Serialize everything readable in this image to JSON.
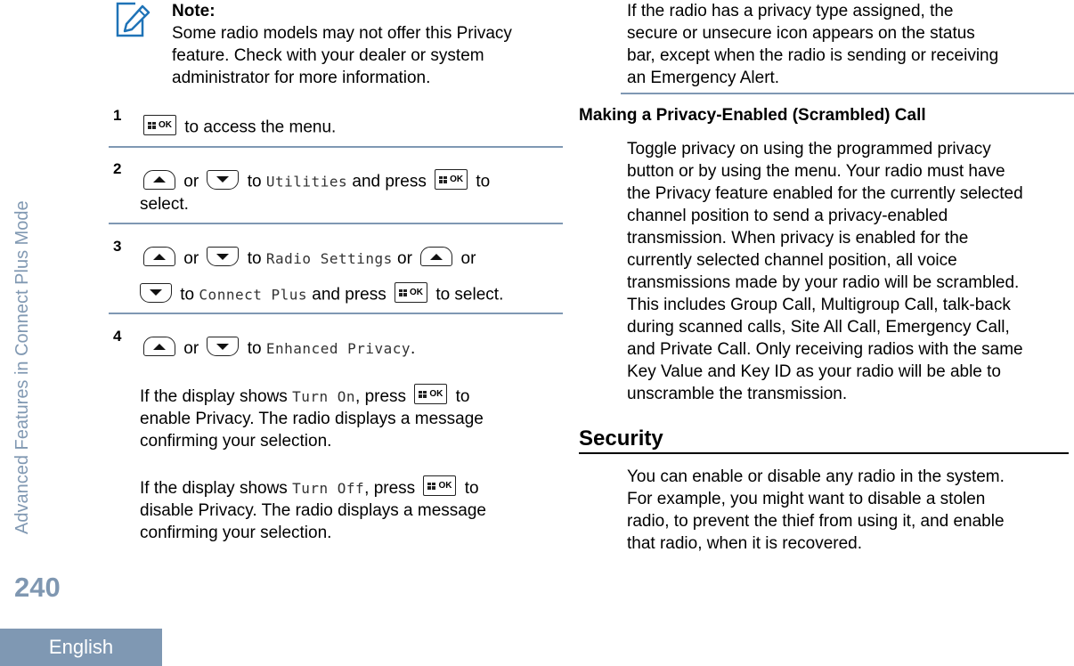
{
  "sidebar": {
    "section_title": "Advanced Features in Connect Plus Mode",
    "page_number": "240",
    "language": "English"
  },
  "colors": {
    "accent": "#7f98b3",
    "note_icon": "#1f73b7"
  },
  "note": {
    "icon": "pencil-note-icon",
    "label": "Note:",
    "lines": [
      "Some radio models may not offer this Privacy",
      "feature. Check with your dealer or system",
      "administrator for more information."
    ]
  },
  "keys": {
    "ok_label": "OK",
    "menu_ok_icon": "menu-ok-key-icon",
    "up_icon": "up-arrow-key-icon",
    "down_icon": "down-arrow-key-icon"
  },
  "steps": [
    {
      "number": "1",
      "text_after_ok": "to access the menu."
    },
    {
      "number": "2",
      "or": "or",
      "to": "to",
      "menu_item": "Utilities",
      "and_press": "and press",
      "to_trail": "to",
      "line2": "select."
    },
    {
      "number": "3",
      "or": "or",
      "to": "to",
      "menu_item_1": "Radio Settings",
      "or_mid": "or",
      "or_end": "or",
      "menu_item_2": "Connect Plus",
      "and_press": "and press",
      "to_select": "to select."
    },
    {
      "number": "4",
      "or": "or",
      "to": "to",
      "menu_item": "Enhanced Privacy",
      "period": ".",
      "on_para": {
        "prefix": "If the display shows",
        "display_value": "Turn On",
        "press": ", press",
        "to": "to",
        "line2": "enable Privacy. The radio displays a message",
        "line3": "confirming your selection."
      },
      "off_para": {
        "prefix": "If the display shows",
        "display_value": "Turn Off",
        "press": ", press",
        "to": "to",
        "line2": "disable Privacy. The radio displays a message",
        "line3": "confirming your selection."
      }
    }
  ],
  "right": {
    "status_para": [
      "If the radio has a privacy type assigned, the",
      "secure or unsecure icon appears on the status",
      "bar, except when the radio is sending or receiving",
      "an Emergency Alert."
    ],
    "scrambled_heading": "Making a Privacy-Enabled (Scrambled) Call",
    "scrambled_para": [
      "Toggle privacy on using the programmed privacy",
      "button or by using the menu. Your radio must have",
      "the Privacy feature enabled for the currently selected",
      "channel position to send a privacy-enabled",
      "transmission. When privacy is enabled for the",
      "currently selected channel position, all voice",
      "transmissions made by your radio will be scrambled.",
      "This includes Group Call, Multigroup Call, talk-back",
      "during scanned calls, Site All Call, Emergency Call,",
      "and Private Call. Only receiving radios with the same",
      "Key Value and Key ID as your radio will be able to",
      "unscramble the transmission."
    ],
    "security_heading": "Security",
    "security_para": [
      "You can enable or disable any radio in the system.",
      "For example, you might want to disable a stolen",
      "radio, to prevent the thief from using it, and enable",
      "that radio, when it is recovered."
    ]
  }
}
